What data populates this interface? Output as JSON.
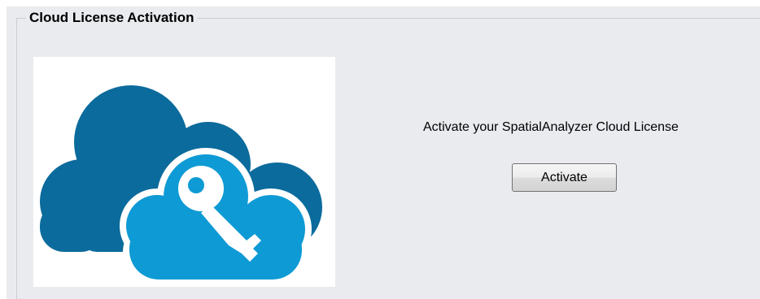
{
  "group": {
    "title": "Cloud License Activation"
  },
  "logo": {
    "icon": "cloud-key-icon",
    "colors": {
      "dark_cloud": "#0b6b9c",
      "light_cloud": "#0e9ad4",
      "key": "#ffffff"
    }
  },
  "main": {
    "prompt": "Activate your SpatialAnalyzer Cloud License",
    "activate_label": "Activate"
  }
}
